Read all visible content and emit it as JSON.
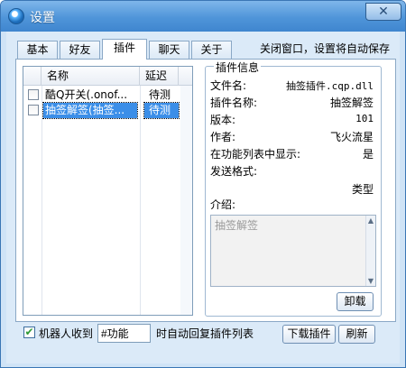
{
  "window": {
    "title": "设置",
    "close_glyph": "✕"
  },
  "tabs": [
    "基本",
    "好友",
    "插件",
    "聊天",
    "关于"
  ],
  "active_tab": "插件",
  "hint": "关闭窗口，设置将自动保存",
  "plugin_list": {
    "columns": [
      "名称",
      "延迟"
    ],
    "rows": [
      {
        "checked": false,
        "name": "酷Q开关(.onof...",
        "delay": "待测",
        "selected": false
      },
      {
        "checked": false,
        "name": "抽签解签(抽签...",
        "delay": "待测",
        "selected": true
      }
    ]
  },
  "plugin_info": {
    "group_title": "插件信息",
    "file_name_label": "文件名:",
    "file_name_value": "抽签插件.cqp.dll",
    "plugin_name_label": "插件名称:",
    "plugin_name_value": "抽签解签",
    "version_label": "版本:",
    "version_value": "101",
    "author_label": "作者:",
    "author_value": "飞火流星",
    "show_in_list_label": "在功能列表中显示:",
    "show_in_list_value": "是",
    "send_format_label": "发送格式:",
    "send_format_value": "类型",
    "intro_label": "介绍:",
    "intro_text": "抽签解签",
    "uninstall_button": "卸载"
  },
  "bottom": {
    "auto_reply_checked": true,
    "check_glyph": "✔",
    "auto_reply_label": "机器人收到",
    "keyword_value": "#功能",
    "after_label": "时自动回复插件列表",
    "download_button": "下载插件",
    "refresh_button": "刷新"
  },
  "colors": {
    "title_bar": "#4f95d9",
    "selection": "#3b8ee8",
    "window_background": "#dbeaf8"
  }
}
